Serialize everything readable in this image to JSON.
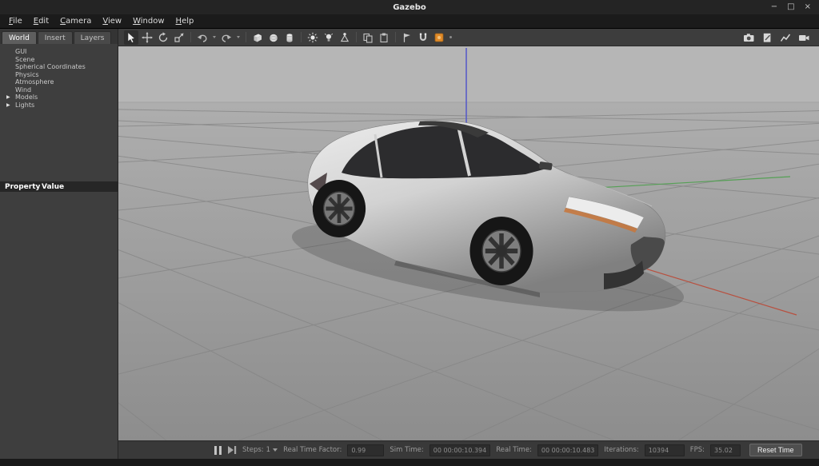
{
  "window": {
    "title": "Gazebo",
    "controls": {
      "minimize": "−",
      "maximize": "□",
      "close": "×"
    }
  },
  "menu": {
    "items": [
      "File",
      "Edit",
      "Camera",
      "View",
      "Window",
      "Help"
    ]
  },
  "sidebar": {
    "tabs": [
      {
        "label": "World",
        "active": true
      },
      {
        "label": "Insert",
        "active": false
      },
      {
        "label": "Layers",
        "active": false
      }
    ],
    "tree": [
      {
        "label": "GUI",
        "expandable": false
      },
      {
        "label": "Scene",
        "expandable": false
      },
      {
        "label": "Spherical Coordinates",
        "expandable": false
      },
      {
        "label": "Physics",
        "expandable": false
      },
      {
        "label": "Atmosphere",
        "expandable": false
      },
      {
        "label": "Wind",
        "expandable": false
      },
      {
        "label": "Models",
        "expandable": true
      },
      {
        "label": "Lights",
        "expandable": true
      }
    ],
    "property_table": {
      "property_header": "Property",
      "value_header": "Value"
    }
  },
  "viewport_toolbar": {
    "icons": [
      "select-arrow-icon",
      "translate-icon",
      "rotate-icon",
      "scale-icon",
      "undo-icon",
      "redo-icon",
      "box-shape-icon",
      "sphere-shape-icon",
      "cylinder-shape-icon",
      "directional-light-icon",
      "point-light-icon",
      "spot-light-icon",
      "copy-icon",
      "paste-icon",
      "align-icon",
      "snap-icon",
      "model-editor-orange-icon"
    ],
    "right_icons": [
      "screenshot-camera-icon",
      "log-record-icon",
      "plot-icon",
      "video-record-icon"
    ]
  },
  "scene": {
    "model": "Toyota Prius",
    "axis_colors": {
      "x_red": "#b8503f",
      "y_green": "#55a055",
      "z_blue": "#5257c8"
    }
  },
  "simbar": {
    "steps_label": "Steps:",
    "steps_value": "1",
    "real_time_factor_label": "Real Time Factor:",
    "real_time_factor_value": "0.99",
    "sim_time_label": "Sim Time:",
    "sim_time_value": "00 00:00:10.394",
    "real_time_label": "Real Time:",
    "real_time_value": "00 00:00:10.483",
    "iterations_label": "Iterations:",
    "iterations_value": "10394",
    "fps_label": "FPS:",
    "fps_value": "35.02",
    "reset_button_label": "Reset Time"
  }
}
